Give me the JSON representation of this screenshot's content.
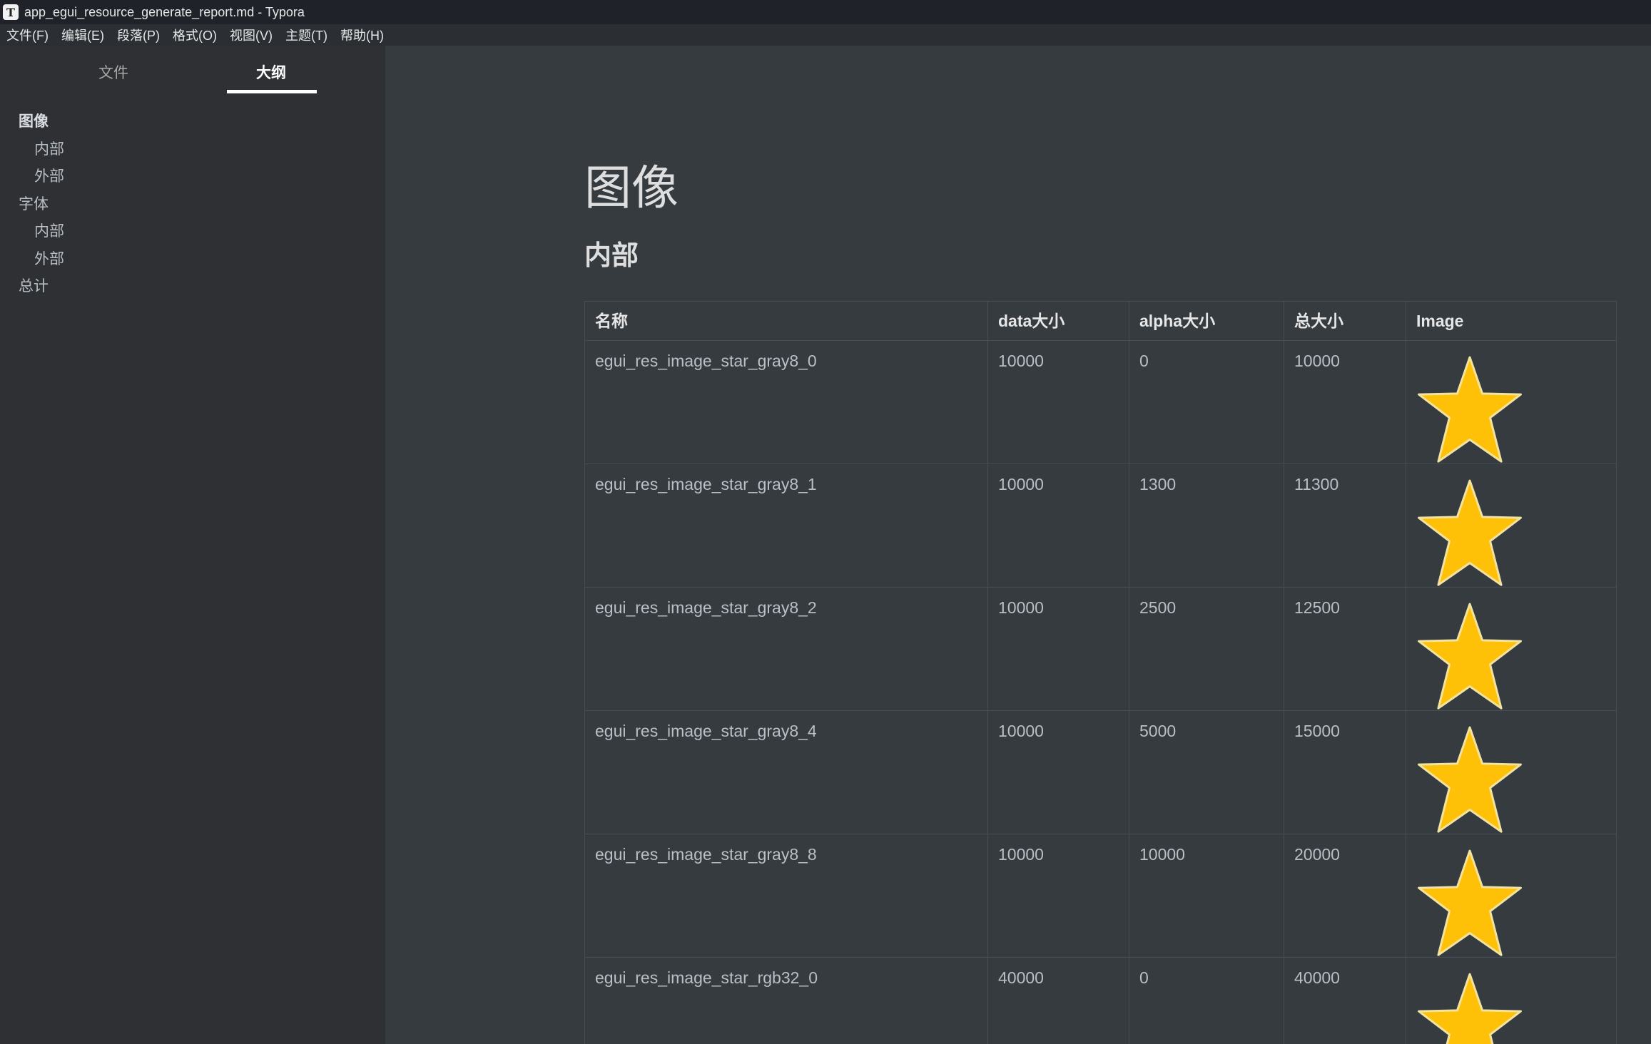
{
  "window": {
    "title": "app_egui_resource_generate_report.md - Typora",
    "app_icon_letter": "T"
  },
  "menu": [
    "文件(F)",
    "编辑(E)",
    "段落(P)",
    "格式(O)",
    "视图(V)",
    "主题(T)",
    "帮助(H)"
  ],
  "sidebar": {
    "tabs": {
      "files": "文件",
      "outline": "大纲"
    },
    "active_tab": "outline",
    "outline": [
      {
        "label": "图像",
        "level": 1,
        "active": true
      },
      {
        "label": "内部",
        "level": 2
      },
      {
        "label": "外部",
        "level": 2
      },
      {
        "label": "字体",
        "level": 1
      },
      {
        "label": "内部",
        "level": 2
      },
      {
        "label": "外部",
        "level": 2
      },
      {
        "label": "总计",
        "level": 1
      }
    ]
  },
  "document": {
    "h1": "图像",
    "h2": "内部",
    "table": {
      "headers": [
        "名称",
        "data大小",
        "alpha大小",
        "总大小",
        "Image"
      ],
      "rows": [
        {
          "name": "egui_res_image_star_gray8_0",
          "data": "10000",
          "alpha": "0",
          "total": "10000",
          "image": "star-image"
        },
        {
          "name": "egui_res_image_star_gray8_1",
          "data": "10000",
          "alpha": "1300",
          "total": "11300",
          "image": "star-image"
        },
        {
          "name": "egui_res_image_star_gray8_2",
          "data": "10000",
          "alpha": "2500",
          "total": "12500",
          "image": "star-image"
        },
        {
          "name": "egui_res_image_star_gray8_4",
          "data": "10000",
          "alpha": "5000",
          "total": "15000",
          "image": "star-image"
        },
        {
          "name": "egui_res_image_star_gray8_8",
          "data": "10000",
          "alpha": "10000",
          "total": "20000",
          "image": "star-image"
        },
        {
          "name": "egui_res_image_star_rgb32_0",
          "data": "40000",
          "alpha": "0",
          "total": "40000",
          "image": "star-image"
        }
      ]
    }
  },
  "colors": {
    "star_fill": "#FFC107",
    "star_stroke": "#f2e3a0",
    "editor_bg": "#363b40",
    "sidebar_bg": "#2e3033"
  }
}
